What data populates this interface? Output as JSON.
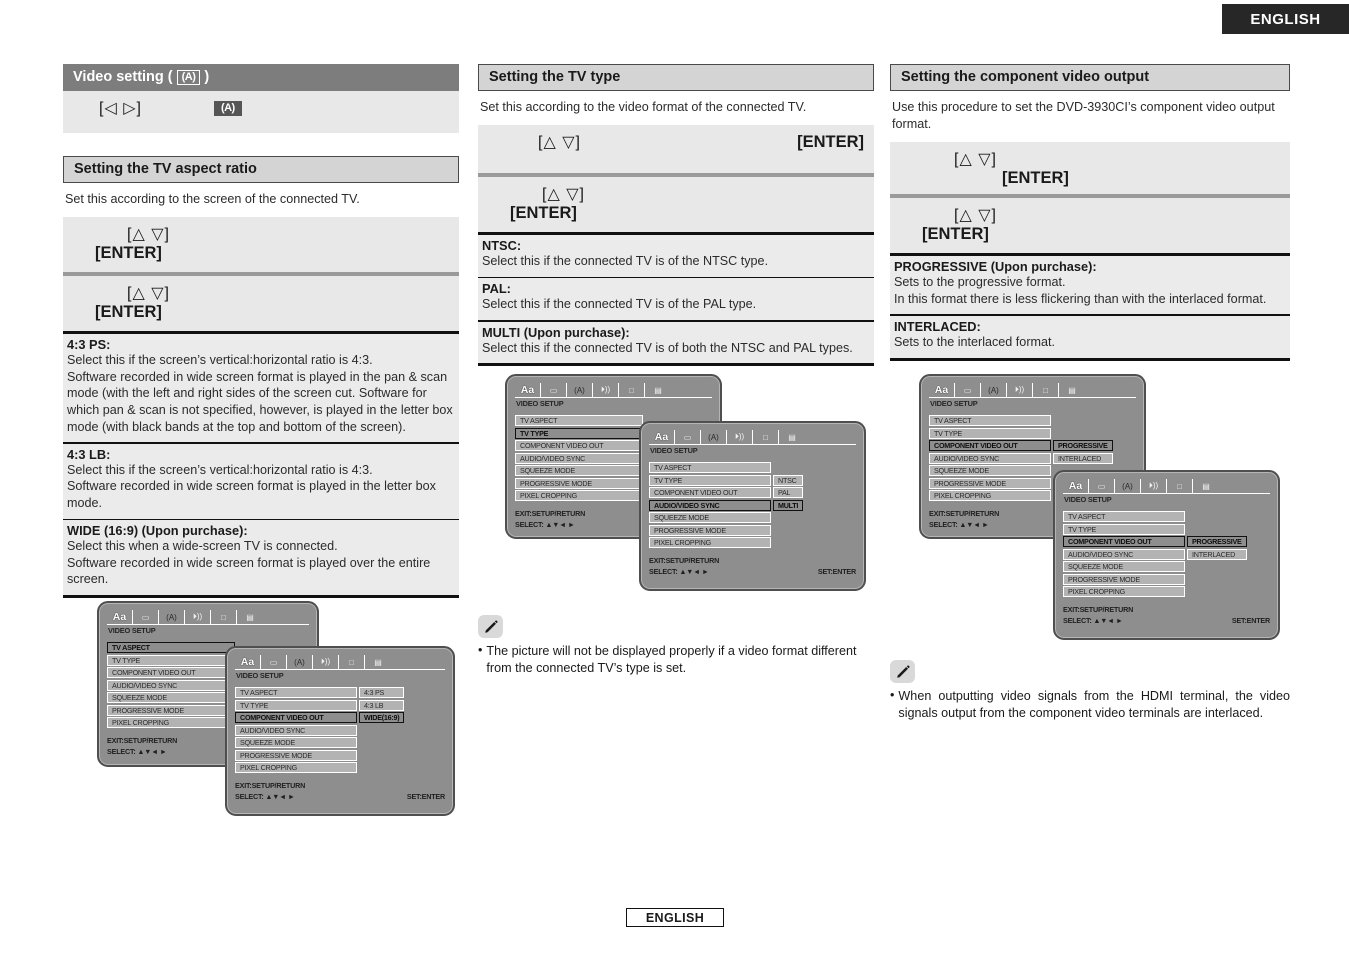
{
  "header": {
    "language_tab": "ENGLISH"
  },
  "footer": {
    "language_tab": "ENGLISH"
  },
  "icons": {
    "video_chip": "(A)",
    "pencil": "pencil-icon",
    "arrow_lr": "[◁ ▷]",
    "arrow_ud": "[△ ▽]",
    "enter": "[ENTER]"
  },
  "left_column": {
    "banner": {
      "prefix": "Video setting (",
      "chip": "(A)",
      "suffix": ")"
    },
    "keybox_top": {
      "arrows": "[◁ ▷]",
      "chip": "(A)"
    },
    "section": {
      "heading": "Setting the TV aspect ratio",
      "lead": "Set this according to the screen of the connected TV.",
      "step1": {
        "arrows": "[△  ▽]",
        "enter": "[ENTER]"
      },
      "step2": {
        "arrows": "[△  ▽]",
        "enter": "[ENTER]"
      },
      "definitions": [
        {
          "term": "4:3 PS:",
          "lines": [
            "Select this if the screen’s vertical:horizontal ratio is 4:3.",
            "Software recorded in wide screen format is played in the pan & scan mode (with the left and right sides of the screen cut. Software for which pan & scan is not specified, however, is played in the letter box mode (with black bands at the top and bottom of the screen)."
          ]
        },
        {
          "term": "4:3 LB:",
          "lines": [
            "Select this if the screen’s vertical:horizontal ratio is 4:3.",
            "Software recorded in wide screen format is played in the letter box mode."
          ]
        },
        {
          "term": "WIDE (16:9) (Upon purchase):",
          "lines": [
            "Select this when a wide-screen TV is connected.",
            "Software recorded in wide screen format is played over the entire screen."
          ]
        }
      ]
    }
  },
  "middle_column": {
    "section": {
      "heading": "Setting the TV type",
      "lead": "Set this according to the video format of the connected TV.",
      "step1": {
        "arrows": "[△ ▽]",
        "enter": "[ENTER]"
      },
      "step2": {
        "arrows": "[△  ▽]",
        "enter": "[ENTER]"
      },
      "definitions": [
        {
          "term": "NTSC:",
          "lines": [
            "Select this if the connected TV is of the NTSC type."
          ]
        },
        {
          "term": "PAL:",
          "lines": [
            "Select this if the connected TV is of the PAL type."
          ]
        },
        {
          "term": "MULTI (Upon purchase):",
          "lines": [
            "Select this if the connected TV is of both the NTSC and PAL types."
          ]
        }
      ]
    },
    "note": {
      "bullet": "•",
      "text": "The picture will not be displayed properly if a video format different from the connected TV’s type is set."
    }
  },
  "right_column": {
    "section": {
      "heading": "Setting the component video output",
      "lead": "Use this procedure to set the DVD-3930CI’s component video output format.",
      "step1": {
        "arrows": "[△ ▽]",
        "enter": "[ENTER]"
      },
      "step2": {
        "arrows": "[△ ▽]",
        "enter": "[ENTER]"
      },
      "definitions": [
        {
          "term": "PROGRESSIVE (Upon purchase):",
          "lines": [
            "Sets to the progressive format.",
            "In this format there is less flickering than with the interlaced format."
          ]
        },
        {
          "term": "INTERLACED:",
          "lines": [
            "Sets to the interlaced format."
          ]
        }
      ]
    },
    "note": {
      "bullet": "•",
      "text": "When outputting video signals from the HDMI terminal, the video signals output from the component video terminals are interlaced."
    }
  },
  "osd": {
    "title": "VIDEO SETUP",
    "iconbar": [
      "Aa",
      "▭",
      "(A)",
      "⏵))",
      "□",
      "▤"
    ],
    "menu_items": [
      "TV ASPECT",
      "TV TYPE",
      "COMPONENT VIDEO OUT",
      "AUDIO/VIDEO SYNC",
      "SQUEEZE MODE",
      "PROGRESSIVE MODE",
      "PIXEL CROPPING"
    ],
    "foot_exit": "EXIT:SETUP/RETURN",
    "foot_select": "SELECT: ▲▼◄ ►",
    "foot_set": "SET:ENTER",
    "screens": {
      "left_1": {
        "highlight": "TV ASPECT",
        "values": []
      },
      "left_2": {
        "highlight": "COMPONENT VIDEO OUT",
        "values": [
          "4:3 PS",
          "4:3 LB",
          "WIDE(16:9)"
        ],
        "cursor": "WIDE(16:9)",
        "values_offset": 0
      },
      "mid_1": {
        "highlight": "TV TYPE",
        "values": []
      },
      "mid_2": {
        "highlight": "AUDIO/VIDEO SYNC",
        "values": [
          "NTSC",
          "PAL",
          "MULTI"
        ],
        "cursor": "MULTI",
        "values_offset": 1
      },
      "right_1": {
        "highlight": "COMPONENT VIDEO OUT",
        "values": [
          "PROGRESSIVE",
          "INTERLACED"
        ],
        "cursor": "PROGRESSIVE",
        "values_offset": 2
      },
      "right_2": {
        "highlight": "COMPONENT VIDEO OUT",
        "values": [
          "PROGRESSIVE",
          "INTERLACED"
        ],
        "cursor": "PROGRESSIVE",
        "values_offset": 2
      }
    }
  }
}
